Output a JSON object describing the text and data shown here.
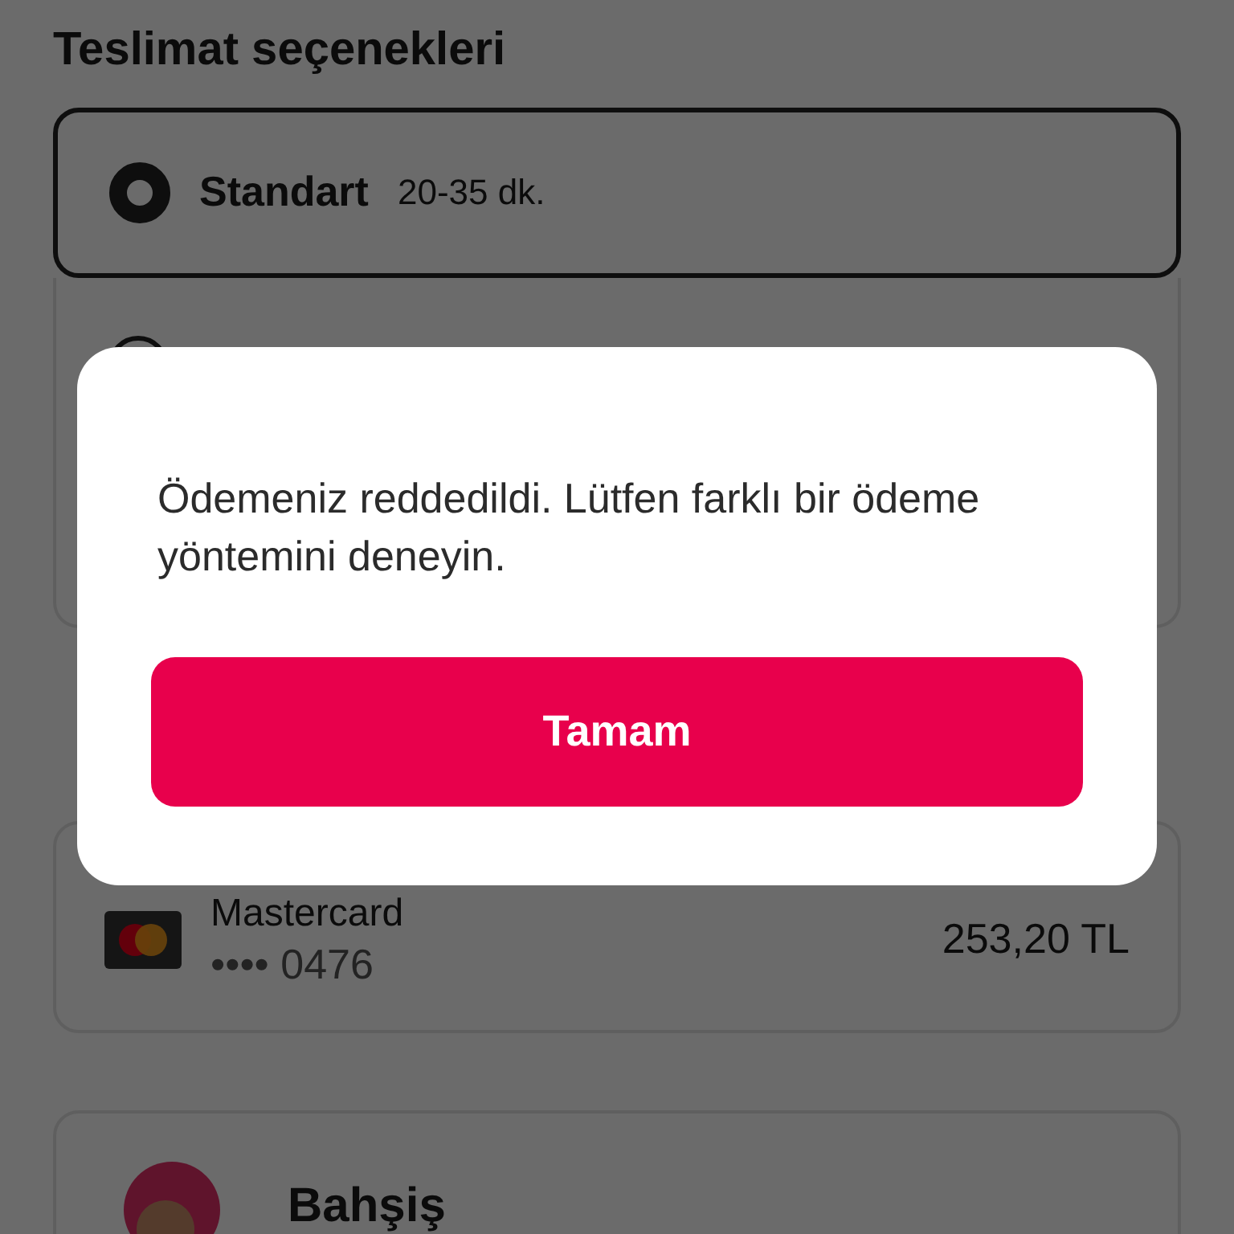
{
  "delivery": {
    "title": "Teslimat seçenekleri",
    "options": [
      {
        "label": "Standart",
        "time": "20-35 dk.",
        "selected": true
      },
      {
        "selected": false
      }
    ]
  },
  "payment": {
    "card": {
      "brand": "Mastercard",
      "number": "•••• 0476",
      "amount": "253,20 TL"
    }
  },
  "tip": {
    "title": "Bahşiş"
  },
  "dialog": {
    "message": "Ödemeniz reddedildi. Lütfen farklı bir ödeme yöntemini deneyin.",
    "button": "Tamam"
  }
}
